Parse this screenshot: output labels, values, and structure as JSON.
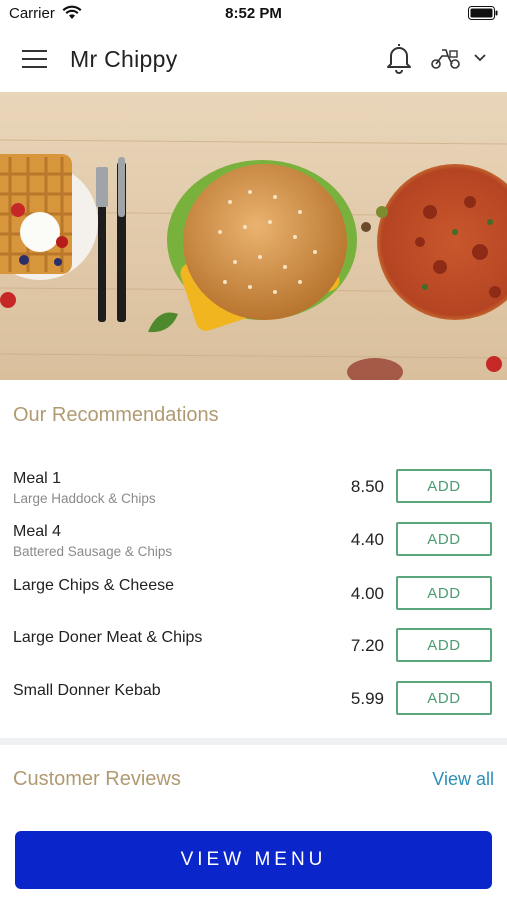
{
  "status_bar": {
    "carrier": "Carrier",
    "time": "8:52 PM"
  },
  "header": {
    "title": "Mr Chippy"
  },
  "icons": {
    "menu": "hamburger-menu-icon",
    "notifications": "bell-icon",
    "delivery": "scooter-icon",
    "dropdown": "chevron-down-icon"
  },
  "recommendations": {
    "title": "Our Recommendations",
    "items": [
      {
        "name": "Meal 1",
        "description": "Large Haddock & Chips",
        "price": "8.50",
        "action": "ADD"
      },
      {
        "name": "Meal 4",
        "description": "Battered Sausage & Chips",
        "price": "4.40",
        "action": "ADD"
      },
      {
        "name": "Large Chips & Cheese",
        "description": "",
        "price": "4.00",
        "action": "ADD"
      },
      {
        "name": "Large Doner Meat & Chips",
        "description": "",
        "price": "7.20",
        "action": "ADD"
      },
      {
        "name": "Small Donner Kebab",
        "description": "",
        "price": "5.99",
        "action": "ADD"
      }
    ]
  },
  "reviews": {
    "title": "Customer Reviews",
    "view_all": "View all"
  },
  "footer": {
    "view_menu": "VIEW MENU"
  },
  "colors": {
    "accent_button": "#0a25c9",
    "add_button_border": "#5aa57c",
    "section_title": "#b09a72",
    "link": "#2b8fb8"
  }
}
